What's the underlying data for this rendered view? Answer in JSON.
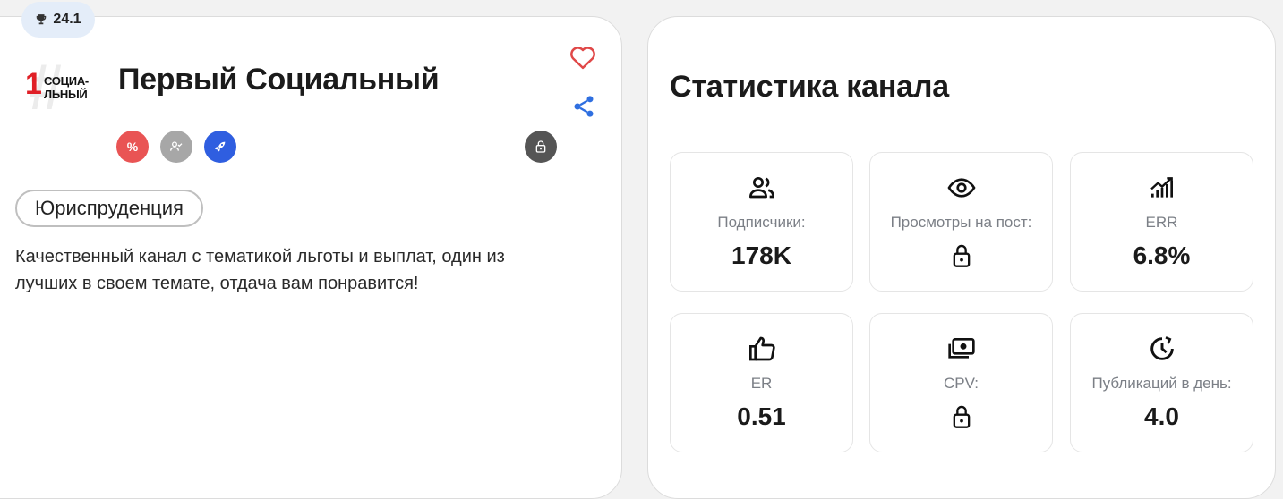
{
  "channel": {
    "rating": "24.1",
    "logo": {
      "number": "1",
      "word_line1": "СОЦИА-",
      "word_line2": "ЛЬНЫЙ"
    },
    "title": "Первый Социальный",
    "badges": [
      {
        "name": "discount",
        "symbol": "%",
        "color": "#e95454"
      },
      {
        "name": "verified",
        "color": "#a7a7a7"
      },
      {
        "name": "boost",
        "color": "#2f5ee0"
      },
      {
        "name": "locked",
        "color": "#555555"
      }
    ],
    "category": "Юриспруденция",
    "description": "Качественный канал с тематикой льготы и выплат, один из лучших в своем темате, отдача вам понравится!"
  },
  "stats": {
    "title": "Статистика канала",
    "items": [
      {
        "icon": "users-icon",
        "label": "Подписчики:",
        "value": "178K"
      },
      {
        "icon": "eye-icon",
        "label": "Просмотры на пост:",
        "value": "",
        "locked": true
      },
      {
        "icon": "chart-icon",
        "label": "ERR",
        "value": "6.8%"
      },
      {
        "icon": "thumb-up-icon",
        "label": "ER",
        "value": "0.51"
      },
      {
        "icon": "money-icon",
        "label": "CPV:",
        "value": "",
        "locked": true
      },
      {
        "icon": "clock-icon",
        "label": "Публикаций в день:",
        "value": "4.0"
      }
    ]
  },
  "colors": {
    "heart": "#e04848",
    "share": "#2f6fe0",
    "accent": "#2f5ee0"
  }
}
